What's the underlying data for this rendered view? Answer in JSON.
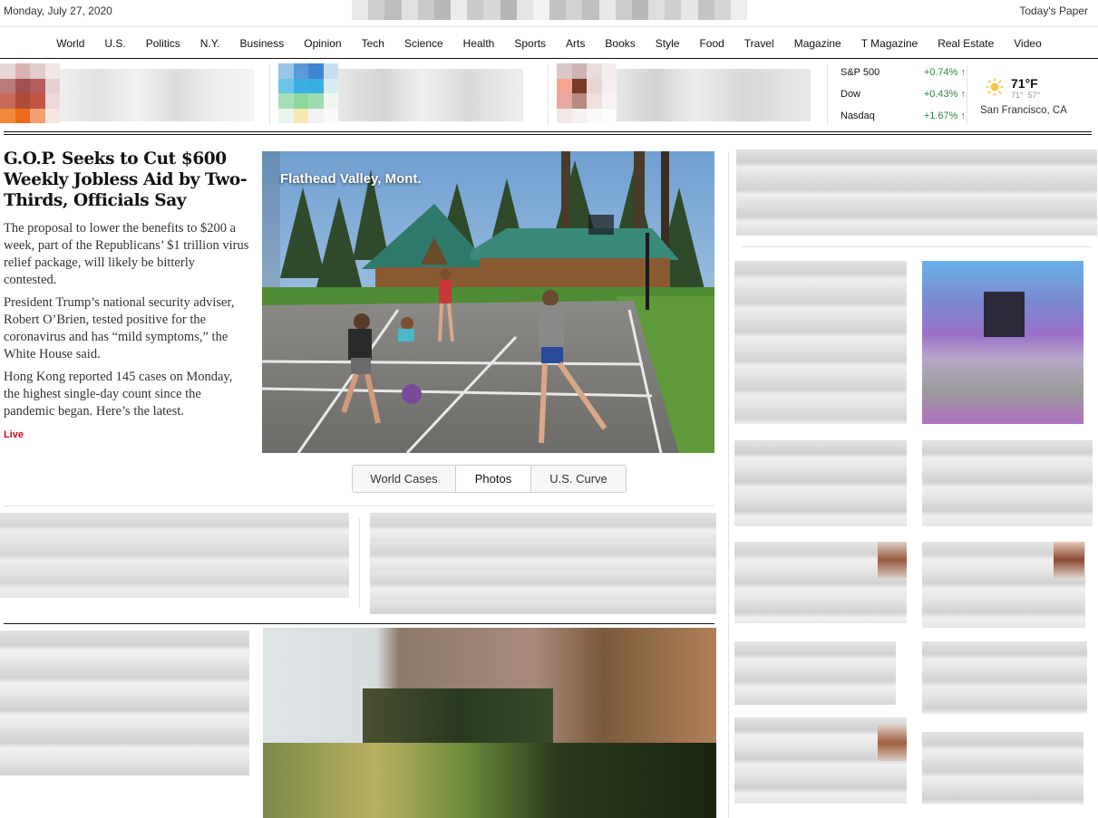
{
  "topbar": {
    "date": "Monday, July 27, 2020",
    "todays_paper": "Today's Paper"
  },
  "nav": {
    "items": [
      "World",
      "U.S.",
      "Politics",
      "N.Y.",
      "Business",
      "Opinion",
      "Tech",
      "Science",
      "Health",
      "Sports",
      "Arts",
      "Books",
      "Style",
      "Food",
      "Travel",
      "Magazine",
      "T Magazine",
      "Real Estate",
      "Video"
    ]
  },
  "markets": [
    {
      "name": "S&P 500",
      "change": "+0.74%",
      "arrow": "↑"
    },
    {
      "name": "Dow",
      "change": "+0.43%",
      "arrow": "↑"
    },
    {
      "name": "Nasdaq",
      "change": "+1.67%",
      "arrow": "↑"
    }
  ],
  "weather": {
    "temp": "71°F",
    "high": "71°",
    "low": "57°",
    "city": "San Francisco, CA",
    "icon": "sun-icon"
  },
  "lead": {
    "headline": "G.O.P. Seeks to Cut $600 Weekly Jobless Aid by Two-Thirds, Officials Say",
    "summaries": [
      "The proposal to lower the benefits to $200 a week, part of the Republicans’ $1 trillion virus relief package, will likely be bitterly contested.",
      "President Trump’s national security adviser, Robert O’Brien, tested positive for the coronavirus and has “mild symptoms,” the White House said.",
      "Hong Kong reported 145 cases on Monday, the highest single-day count since the pandemic began. Here’s the latest."
    ],
    "live_label": "Live",
    "photo_caption": "Flathead Valley, Mont.",
    "tabs": [
      "World Cases",
      "Photos",
      "U.S. Curve"
    ],
    "active_tab": "Photos"
  },
  "colors": {
    "accent_red": "#d0021b",
    "market_green": "#2e8540",
    "rule": "#121212",
    "light_rule": "#e2e2e2"
  }
}
